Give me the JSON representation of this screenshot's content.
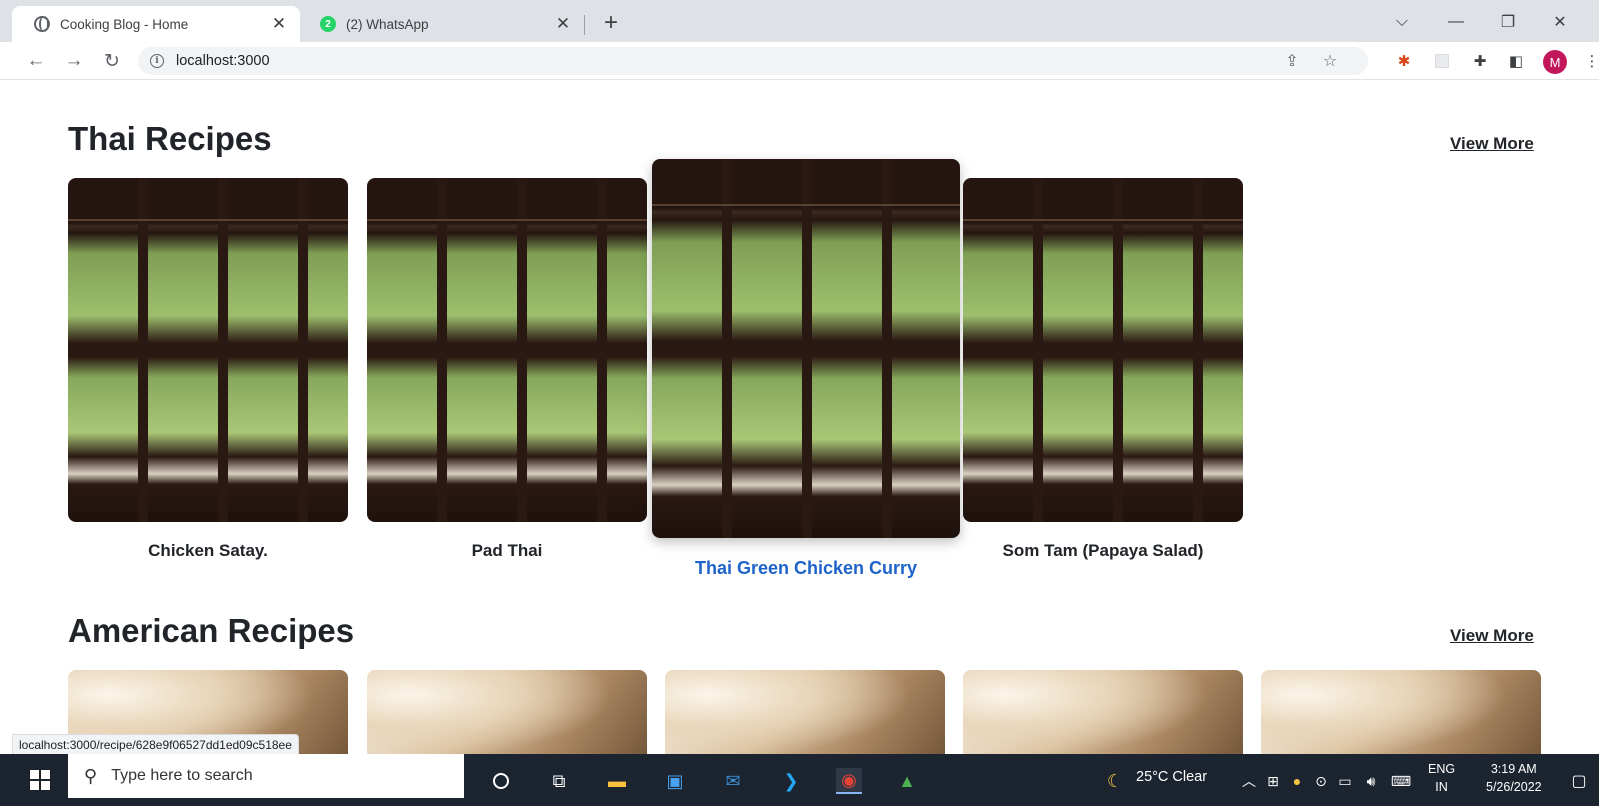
{
  "browser": {
    "tabs": [
      {
        "title": "Cooking Blog - Home",
        "active": true,
        "icon": "globe-icon"
      },
      {
        "title": "(2) WhatsApp",
        "active": false,
        "badge": "2",
        "icon": "whatsapp-icon"
      }
    ],
    "address": "localhost:3000",
    "profile_initial": "M",
    "status_url": "localhost:3000/recipe/628e9f06527dd1ed09c518ee"
  },
  "sections": [
    {
      "title": "Thai Recipes",
      "view_more": "View More",
      "cards": [
        {
          "label": "Chicken Satay."
        },
        {
          "label": "Pad Thai"
        },
        {
          "label": "Thai Green Chicken Curry",
          "hovered": true
        },
        {
          "label": "Som Tam (Papaya Salad)"
        }
      ]
    },
    {
      "title": "American Recipes",
      "view_more": "View More",
      "cards": [
        {},
        {},
        {},
        {},
        {}
      ]
    }
  ],
  "taskbar": {
    "search_placeholder": "Type here to search",
    "weather": "25°C  Clear",
    "lang_top": "ENG",
    "lang_bottom": "IN",
    "time": "3:19 AM",
    "date": "5/26/2022"
  },
  "colors": {
    "hover_link": "#1e63c9",
    "heading": "#212529",
    "avatar": "#c2185b",
    "whatsapp": "#25d366"
  }
}
